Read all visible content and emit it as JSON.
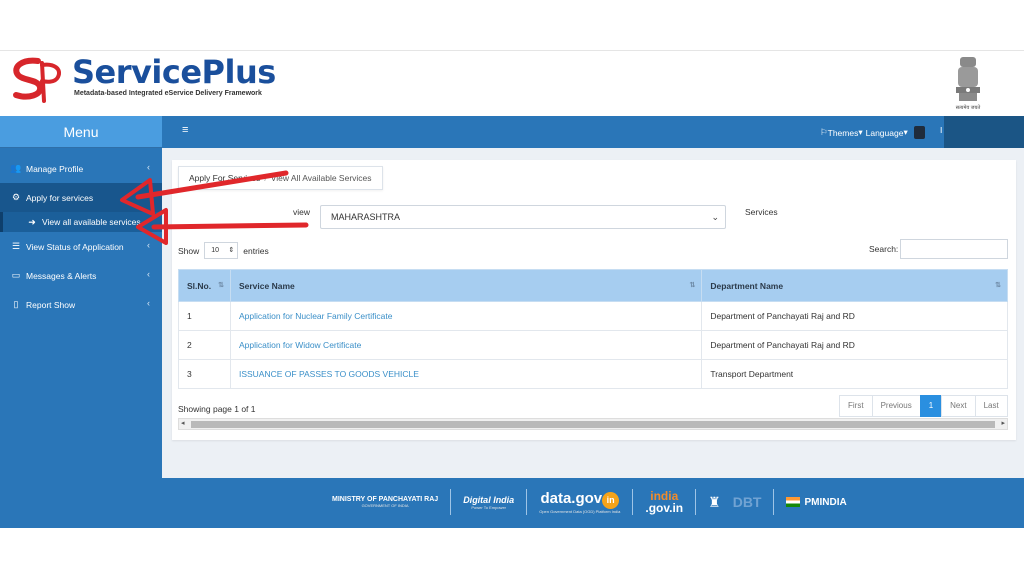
{
  "brand": {
    "title_part1": "Service",
    "title_part2": "Plus",
    "subtitle": "Metadata-based Integrated eService Delivery Framework",
    "emblem_caption": "सत्यमेव जयते"
  },
  "sidebar": {
    "menu_title": "Menu",
    "items": [
      {
        "label": "Manage Profile",
        "icon": "users-icon"
      },
      {
        "label": "Apply for services",
        "icon": "gears-icon"
      },
      {
        "label": "View all available services",
        "icon": "arrow-circle-icon"
      },
      {
        "label": "View Status of Application",
        "icon": "list-icon"
      },
      {
        "label": "Messages & Alerts",
        "icon": "comment-icon"
      },
      {
        "label": "Report Show",
        "icon": "file-icon"
      }
    ]
  },
  "topbar": {
    "themes": "Themes",
    "language": "Language",
    "user_initial": "I"
  },
  "breadcrumb": {
    "item1": "Apply For Services",
    "separator": "/",
    "item2": "View All Available Services"
  },
  "filters": {
    "view_label": "view",
    "state_value": "MAHARASHTRA",
    "services_label": "Services"
  },
  "table_controls": {
    "show_label": "Show",
    "entries_value": "10",
    "entries_label": "entries",
    "search_label": "Search:"
  },
  "table": {
    "headers": [
      "Sl.No.",
      "Service Name",
      "Department Name"
    ],
    "rows": [
      {
        "no": "1",
        "service": "Application for Nuclear Family Certificate",
        "dept": "Department of Panchayati Raj and RD"
      },
      {
        "no": "2",
        "service": "Application for Widow Certificate",
        "dept": "Department of Panchayati Raj and RD"
      },
      {
        "no": "3",
        "service": "ISSUANCE OF PASSES TO GOODS VEHICLE",
        "dept": "Transport Department"
      }
    ]
  },
  "pagination": {
    "info": "Showing page 1 of 1",
    "first": "First",
    "previous": "Previous",
    "current": "1",
    "next": "Next",
    "last": "Last"
  },
  "footer": {
    "ministry": "MINISTRY OF PANCHAYATI RAJ",
    "ministry_sub": "GOVERNMENT OF INDIA",
    "digital_india": "Digital India",
    "digital_india_sub": "Power To Empower",
    "datagov": "data.gov",
    "datagov_in": "in",
    "datagov_sub": "Open Government Data (OGD) Platform India",
    "indiagov_top": "india",
    "indiagov_bottom": ".gov.in",
    "dbt": "DBT",
    "pmindia": "PMINDIA"
  },
  "colors": {
    "sidebar_blue": "#2a76b8",
    "header_row": "#a6cdf0",
    "link": "#3a8fc8",
    "annotation_red": "#e0272b"
  }
}
